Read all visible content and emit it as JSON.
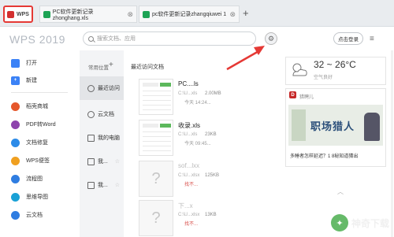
{
  "tabs": {
    "home": "WPS",
    "doc1": "PC软件更新记录zhonghang.xls",
    "doc2": "pc软件更新记录zhangqiuwei 1",
    "add": "+"
  },
  "header": {
    "brand": "WPS 2019",
    "search_placeholder": "搜索文档、应用",
    "login": "点击登录",
    "menu": "≡"
  },
  "nav": {
    "items": [
      {
        "label": "打开",
        "icon": "folder-icon",
        "color": "#3b82f6"
      },
      {
        "label": "新建",
        "icon": "plus-square-icon",
        "color": "#3b82f6"
      },
      {
        "label": "稻壳商城",
        "icon": "shop-icon",
        "color": "#e5572b"
      },
      {
        "label": "PDF转Word",
        "icon": "pdf-icon",
        "color": "#8e44ad"
      },
      {
        "label": "文档修复",
        "icon": "repair-icon",
        "color": "#2c8be8"
      },
      {
        "label": "WPS便签",
        "icon": "note-icon",
        "color": "#f0a020"
      },
      {
        "label": "流程图",
        "icon": "flowchart-icon",
        "color": "#2f7de1"
      },
      {
        "label": "思维导图",
        "icon": "mindmap-icon",
        "color": "#1aa1d6"
      },
      {
        "label": "云文档",
        "icon": "cloud-doc-icon",
        "color": "#2f7de1"
      }
    ]
  },
  "locations": {
    "header": "常用位置",
    "add": "+",
    "items": [
      {
        "label": "最近访问",
        "active": true
      },
      {
        "label": "云文档",
        "active": false
      },
      {
        "label": "我的电脑",
        "active": false
      },
      {
        "label": "我...",
        "active": false
      },
      {
        "label": "我...",
        "active": false
      }
    ]
  },
  "recent": {
    "header": "最近访问文档",
    "files": [
      {
        "name": "PC....ls",
        "path": "C:\\U...xls",
        "size": "2.00MB",
        "time": "今天 14:24...",
        "missing": false
      },
      {
        "name": "收录.xls",
        "path": "C:\\U...xls",
        "size": "23KB",
        "time": "今天 09:45...",
        "missing": false
      },
      {
        "name": "sof...lxx",
        "path": "C:\\U...xlsx",
        "size": "125KB",
        "time": "找不...",
        "missing": true
      },
      {
        "name": "下...x",
        "path": "C:\\U...xlsx",
        "size": "13KB",
        "time": "找不...",
        "missing": true
      }
    ]
  },
  "weather": {
    "temp": "32 ~ 26°C",
    "air": "空气良好"
  },
  "news": {
    "source": "猎聘儿",
    "banner": "职场猎人",
    "caption": "多睡者怎样延迟？1 8秘知道猜出"
  },
  "watermark": {
    "text": "神奇下载"
  },
  "colors": {
    "highlight_red": "#e53935",
    "accent_green": "#5cb85c"
  }
}
